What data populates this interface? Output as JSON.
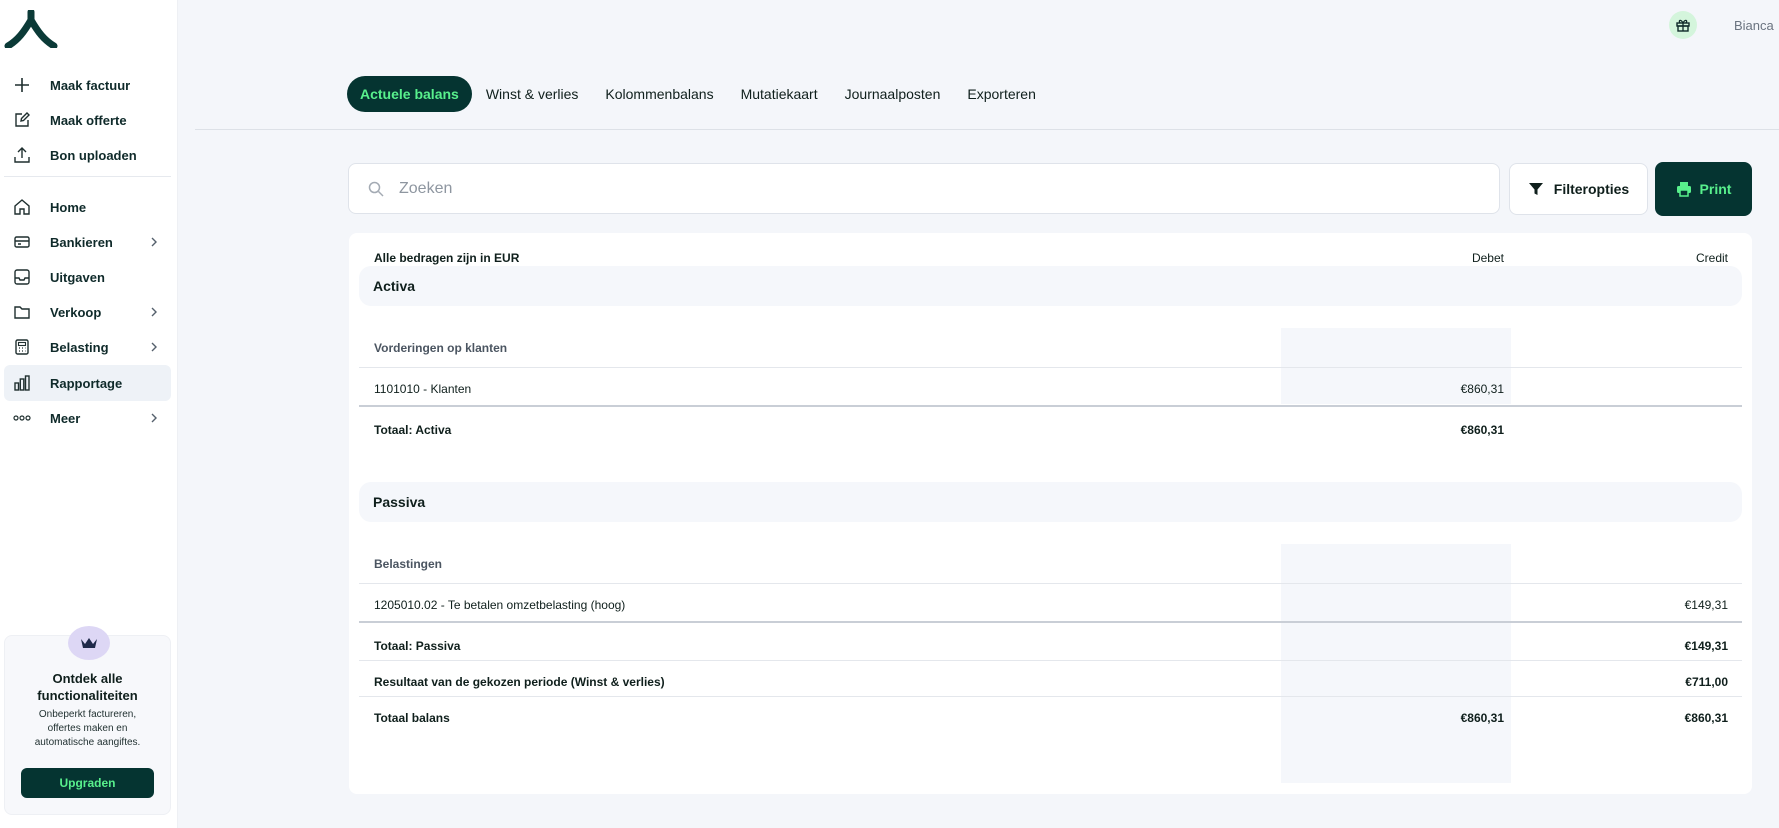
{
  "sidebar": {
    "quick_actions": [
      {
        "label": "Maak factuur",
        "icon": "plus-icon"
      },
      {
        "label": "Maak offerte",
        "icon": "edit-icon"
      },
      {
        "label": "Bon uploaden",
        "icon": "upload-icon"
      }
    ],
    "nav": [
      {
        "label": "Home",
        "icon": "home-icon",
        "has_chevron": false
      },
      {
        "label": "Bankieren",
        "icon": "credit-card-icon",
        "has_chevron": true
      },
      {
        "label": "Uitgaven",
        "icon": "inbox-icon",
        "has_chevron": false
      },
      {
        "label": "Verkoop",
        "icon": "folder-icon",
        "has_chevron": true
      },
      {
        "label": "Belasting",
        "icon": "calculator-icon",
        "has_chevron": true
      },
      {
        "label": "Rapportage",
        "icon": "bar-chart-icon",
        "has_chevron": false,
        "active": true
      },
      {
        "label": "Meer",
        "icon": "dots-icon",
        "has_chevron": true
      }
    ],
    "promo": {
      "title": "Ontdek alle functionaliteiten",
      "description": "Onbeperkt factureren, offertes maken en automatische aangiftes.",
      "button": "Upgraden"
    }
  },
  "header": {
    "user_name": "Bianca"
  },
  "tabs": [
    {
      "label": "Actuele balans",
      "active": true
    },
    {
      "label": "Winst & verlies"
    },
    {
      "label": "Kolommenbalans"
    },
    {
      "label": "Mutatiekaart"
    },
    {
      "label": "Journaalposten"
    },
    {
      "label": "Exporteren"
    }
  ],
  "toolbar": {
    "search_placeholder": "Zoeken",
    "filter_label": "Filteropties",
    "print_label": "Print"
  },
  "report": {
    "currency_note": "Alle bedragen zijn in EUR",
    "col_debet": "Debet",
    "col_credit": "Credit",
    "activa": {
      "title": "Activa",
      "group": "Vorderingen op klanten",
      "row_label": "1101010 - Klanten",
      "row_debet": "€860,31",
      "total_label": "Totaal: Activa",
      "total_debet": "€860,31"
    },
    "passiva": {
      "title": "Passiva",
      "group": "Belastingen",
      "row_label": "1205010.02 - Te betalen omzetbelasting (hoog)",
      "row_credit": "€149,31",
      "total_label": "Totaal: Passiva",
      "total_credit": "€149,31",
      "result_label": "Resultaat van de gekozen periode (Winst & verlies)",
      "result_credit": "€711,00",
      "balance_label": "Totaal balans",
      "balance_debet": "€860,31",
      "balance_credit": "€860,31"
    }
  },
  "colors": {
    "primary_dark": "#053431",
    "accent_green": "#58f08c",
    "band_bg": "#f5f7fb"
  }
}
